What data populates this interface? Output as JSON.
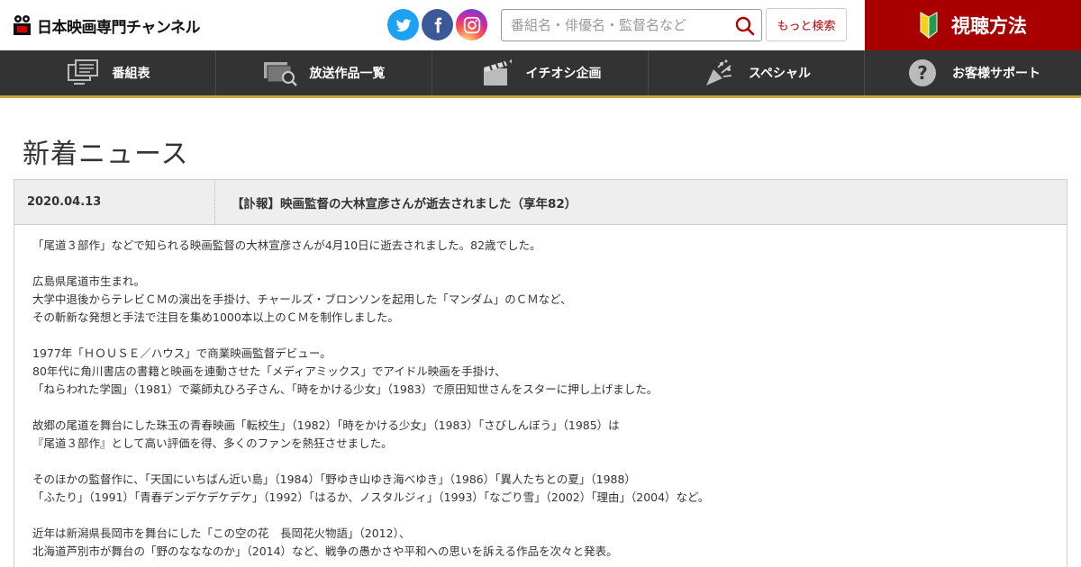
{
  "header": {
    "logo_text": "日本映画専門チャンネル",
    "search_placeholder": "番組名・俳優名・監督名など",
    "more_search_label": "もっと検索",
    "watch_label": "視聴方法"
  },
  "colors": {
    "brand_red": "#a80000",
    "nav_bg": "#333333",
    "nav_accent": "#c8a43c",
    "twitter": "#1da1f2",
    "facebook": "#3b5998"
  },
  "social_icons": [
    "twitter-icon",
    "facebook-icon",
    "instagram-icon"
  ],
  "nav": [
    {
      "label": "番組表",
      "icon": "tv-schedule-icon"
    },
    {
      "label": "放送作品一覧",
      "icon": "film-search-icon"
    },
    {
      "label": "イチオシ企画",
      "icon": "clapperboard-icon"
    },
    {
      "label": "スペシャル",
      "icon": "party-popper-icon"
    },
    {
      "label": "お客様サポート",
      "icon": "question-icon"
    }
  ],
  "page": {
    "title": "新着ニュース"
  },
  "news": {
    "date": "2020.04.13",
    "title": "【訃報】映画監督の大林宣彦さんが逝去されました（享年82）",
    "lines": [
      "「尾道３部作」などで知られる映画監督の大林宣彦さんが4月10日に逝去されました。82歳でした。",
      "",
      "広島県尾道市生まれ。",
      "大学中退後からテレビＣＭの演出を手掛け、チャールズ・ブロンソンを起用した「マンダム」のＣＭなど、",
      "その斬新な発想と手法で注目を集め1000本以上のＣＭを制作しました。",
      "",
      "1977年「ＨＯＵＳＥ／ハウス」で商業映画監督デビュー。",
      "80年代に角川書店の書籍と映画を連動させた「メディアミックス」でアイドル映画を手掛け、",
      "「ねらわれた学園」（1981）で薬師丸ひろ子さん、「時をかける少女」（1983）で原田知世さんをスターに押し上げました。",
      "",
      "故郷の尾道を舞台にした珠玉の青春映画「転校生」（1982）「時をかける少女」（1983）「さびしんぼう」（1985）は",
      "『尾道３部作』として高い評価を得、多くのファンを熱狂させました。",
      "",
      "そのほかの監督作に、「天国にいちばん近い島」（1984）「野ゆき山ゆき海べゆき」（1986）「異人たちとの夏」（1988）",
      "「ふたり」（1991）「青春デンデケデケデケ」（1992）「はるか、ノスタルジィ」（1993）「なごり雪」（2002）「理由」（2004）など。",
      "",
      "近年は新潟県長岡市を舞台にした「この空の花　長岡花火物語」（2012）、",
      "北海道芦別市が舞台の「野のなななのか」（2014）など、戦争の愚かさや平和への思いを訴える作品を次々と発表。"
    ]
  }
}
